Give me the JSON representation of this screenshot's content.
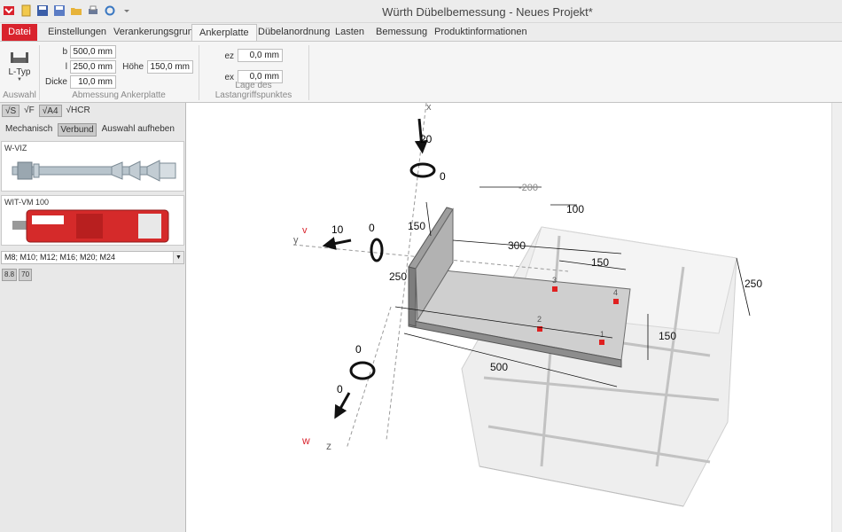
{
  "app": {
    "title": "Würth Dübelbemessung - Neues Projekt*"
  },
  "quick_access": [
    "app-icon",
    "new-icon",
    "save-icon",
    "save-as-icon",
    "open-icon",
    "print-icon",
    "refresh-icon",
    "customize-icon"
  ],
  "tabs": {
    "file": "Datei",
    "settings": "Einstellungen",
    "anchorage": "Verankerungsgrund",
    "plate": "Ankerplatte",
    "arrangement": "Dübelanordnung",
    "loads": "Lasten",
    "design": "Bemessung",
    "product_info": "Produktinformationen"
  },
  "ribbon": {
    "selection": {
      "button_label": "L-Typ",
      "group_label": "Auswahl"
    },
    "dimensions": {
      "b_label": "b",
      "b_value": "500,0 mm",
      "l_label": "l",
      "l_value": "250,0 mm",
      "thickness_label": "Dicke",
      "thickness_value": "10,0 mm",
      "height_label": "Höhe",
      "height_value": "150,0 mm",
      "group_label": "Abmessung Ankerplatte"
    },
    "load_point": {
      "ez_label": "ez",
      "ez_value": "0,0 mm",
      "ex_label": "ex",
      "ex_value": "0,0 mm",
      "group_label": "Lage des Lastangriffspunktes"
    }
  },
  "left_panel": {
    "options": [
      "√S",
      "√F",
      "√A4",
      "√HCR"
    ],
    "types": {
      "mechanical": "Mechanisch",
      "bonded": "Verbund",
      "clear": "Auswahl aufheben"
    },
    "products": [
      {
        "name": "W-VIZ"
      },
      {
        "name": "WIT-VM 100"
      }
    ],
    "sizes": "M8; M10; M12; M16; M20; M24",
    "grades": [
      "8.8",
      "70"
    ]
  },
  "scene": {
    "axes": {
      "x": "x",
      "y": "y",
      "z": "z",
      "v": "v",
      "w": "w"
    },
    "loads": {
      "force_x": "20",
      "moment_x": "0",
      "force_y": "10",
      "moment_y": "0",
      "force_z": "0",
      "moment_z": "0"
    },
    "dims": {
      "d_neg200": "-200",
      "d100": "100",
      "d150_top": "150",
      "d300": "300",
      "d150_a": "150",
      "d250_left": "250",
      "d250_right": "250",
      "d150_b": "150",
      "d500": "500"
    },
    "anchor_labels": [
      "1",
      "2",
      "3",
      "4"
    ]
  },
  "colors": {
    "file_tab": "#d9232d",
    "anchor_red": "#e02020",
    "plate_gray": "#b5b5b5"
  }
}
